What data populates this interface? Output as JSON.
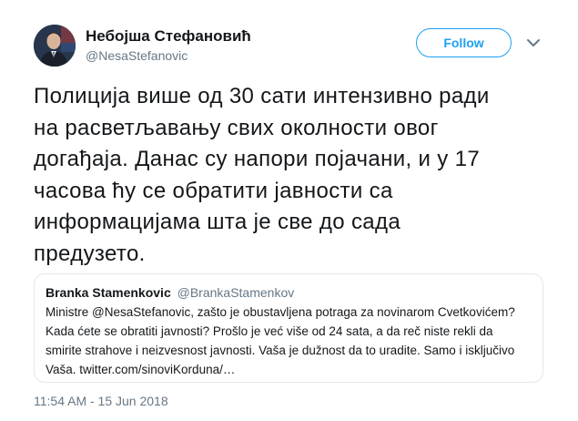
{
  "author": {
    "name": "Небојша Стефановић",
    "handle": "@NesaStefanovic"
  },
  "follow_label": "Follow",
  "tweet_lines": [
    "Полиција више од 30 сати интензивно ради",
    "на расветљавању свих околности овог",
    "догађаја. Данас су напори појачани, и у 17",
    "часова ћу се обратити јавности са",
    "информацијама шта је све до сада",
    "предузето."
  ],
  "quoted_tweet": {
    "name": "Branka Stamenkovic",
    "handle": "@BrankaStamenkov",
    "lines": [
      "Ministre @NesaStefanovic, zašto je obustavljena potraga za novinarom Cvetkovićem?",
      "Kada ćete se obratiti javnosti? Prošlo je već više od 24 sata, a da reč niste rekli da",
      "smirite strahove i neizvesnost javnosti. Vaša je dužnost da to uradite. Samo i isključivo",
      "Vaša. twitter.com/sinoviKorduna/…"
    ]
  },
  "timestamp": "11:54 AM - 15 Jun 2018",
  "icons": {
    "avatar": "profile-photo",
    "menu": "chevron-down-icon"
  },
  "colors": {
    "accent": "#1da1f2",
    "secondary_text": "#657786",
    "border": "#e1e8ed"
  }
}
